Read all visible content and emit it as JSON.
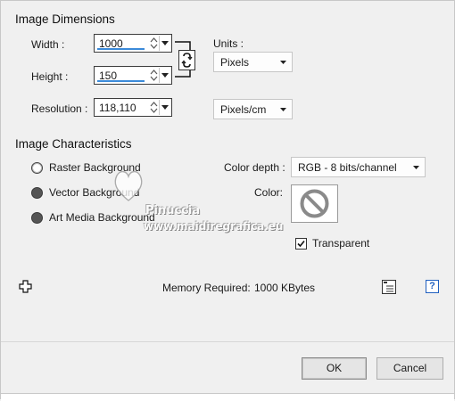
{
  "image_dimensions": {
    "title": "Image Dimensions",
    "width_label": "Width :",
    "width_value": "1000",
    "height_label": "Height :",
    "height_value": "150",
    "resolution_label": "Resolution :",
    "resolution_value": "118,110",
    "units_label": "Units :",
    "units_value": "Pixels",
    "resolution_units_value": "Pixels/cm",
    "lock_icon": "aspect-ratio-lock-icon"
  },
  "image_characteristics": {
    "title": "Image Characteristics",
    "backgrounds": [
      {
        "label": "Raster Background",
        "selected": true
      },
      {
        "label": "Vector Background",
        "selected": false
      },
      {
        "label": "Art Media Background",
        "selected": false
      }
    ],
    "color_depth_label": "Color depth :",
    "color_depth_value": "RGB - 8 bits/channel",
    "color_label": "Color:",
    "transparent_label": "Transparent",
    "transparent_checked": true
  },
  "memory": {
    "label": "Memory Required:",
    "value": "1000 KBytes"
  },
  "watermark": {
    "name": "Pinuccia",
    "url": "www.maidiregrafica.eu"
  },
  "buttons": {
    "ok": "OK",
    "cancel": "Cancel"
  },
  "colors": {
    "accent": "#3b8ad9",
    "help_blue": "#1f5fbf"
  }
}
